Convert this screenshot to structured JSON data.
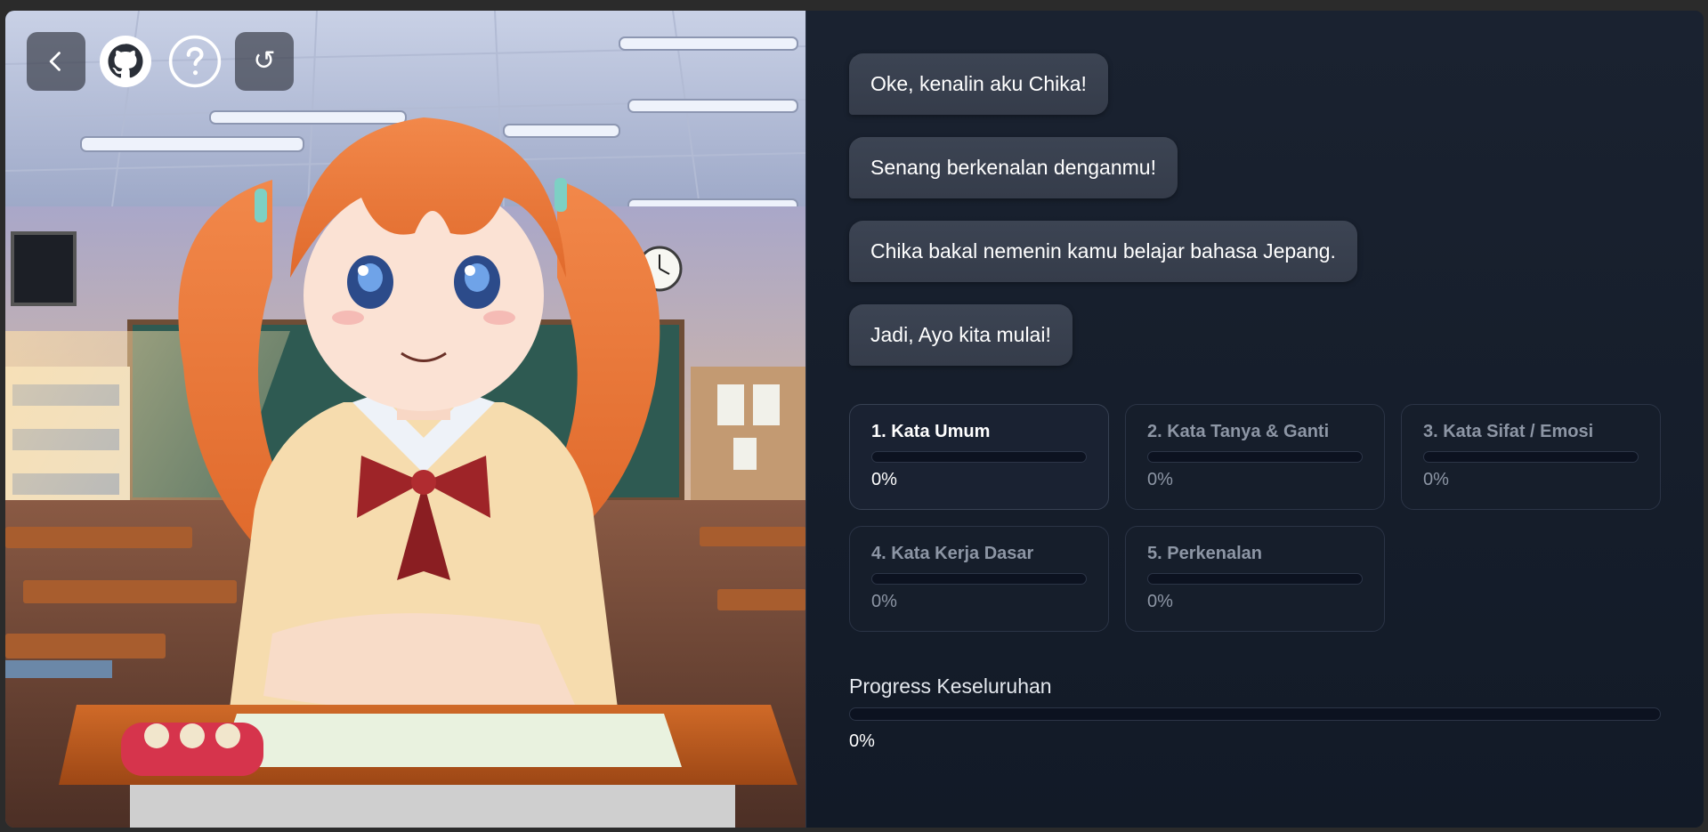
{
  "toolbar": {
    "back_icon": "chevron-left-icon",
    "github_icon": "github-icon",
    "help_icon": "question-circle-icon",
    "reload_icon": "reload-icon",
    "reload_glyph": "↺"
  },
  "chat": {
    "messages": [
      "Oke, kenalin aku Chika!",
      "Senang berkenalan denganmu!",
      "Chika bakal nemenin kamu belajar bahasa Jepang.",
      "Jadi, Ayo kita mulai!"
    ]
  },
  "lessons": [
    {
      "title": "1. Kata Umum",
      "progress": "0%",
      "active": true
    },
    {
      "title": "2. Kata Tanya & Ganti",
      "progress": "0%",
      "active": false
    },
    {
      "title": "3. Kata Sifat / Emosi",
      "progress": "0%",
      "active": false
    },
    {
      "title": "4. Kata Kerja Dasar",
      "progress": "0%",
      "active": false
    },
    {
      "title": "5. Perkenalan",
      "progress": "0%",
      "active": false
    }
  ],
  "overall": {
    "label": "Progress Keseluruhan",
    "progress": "0%"
  },
  "colors": {
    "panel_bg": "#141b27",
    "bubble_bg": "#3a4250",
    "progress_fill": "#4f8cff"
  }
}
